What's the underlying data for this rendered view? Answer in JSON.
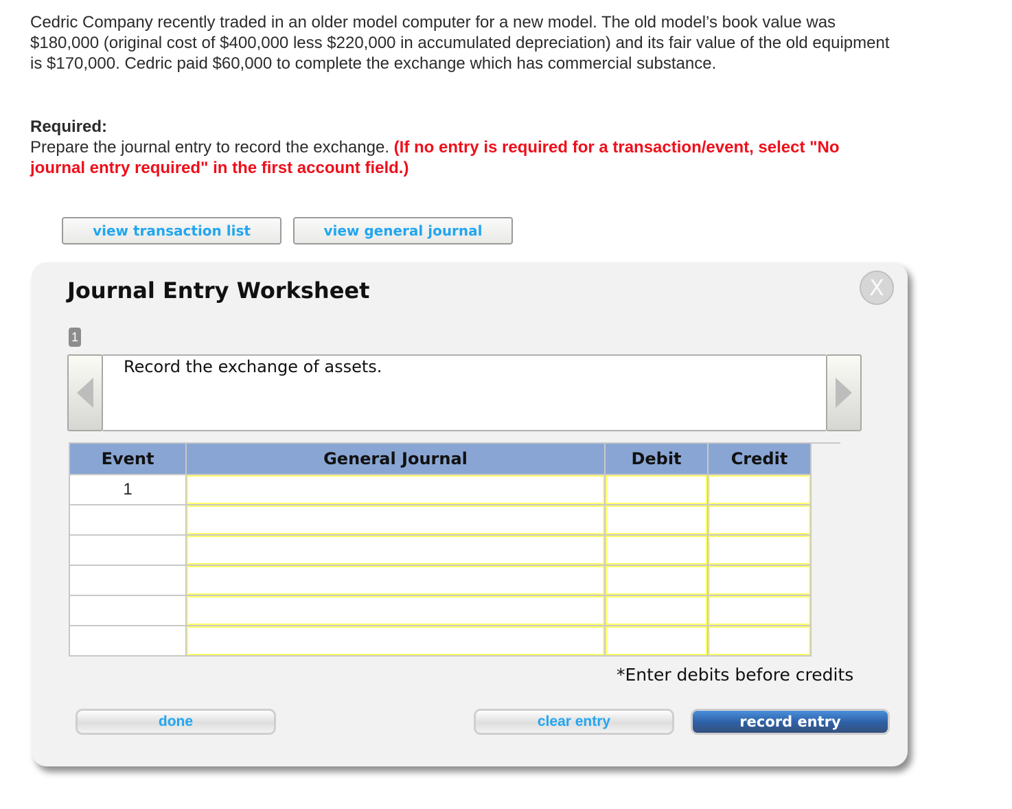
{
  "problem": {
    "text": "Cedric Company recently traded in an older model computer for a new model. The old model’s book value was $180,000 (original cost of $400,000 less $220,000 in accumulated depreciation) and its fair value of the old equipment is $170,000. Cedric paid $60,000 to complete the exchange which has commercial substance."
  },
  "required": {
    "label": "Required:",
    "instruction": "Prepare the journal entry to record the exchange. ",
    "note_red": "(If no entry is required for a transaction/event, select \"No journal entry required\" in the first account field.)"
  },
  "top_buttons": {
    "transaction_list": "view transaction list",
    "general_journal": "view general journal"
  },
  "worksheet": {
    "title": "Journal Entry Worksheet",
    "close_icon": "X",
    "step_number": "1",
    "description": "Record the exchange of assets.",
    "prev_icon": "left-arrow",
    "next_icon": "right-arrow",
    "table": {
      "headers": [
        "Event",
        "General Journal",
        "Debit",
        "Credit"
      ],
      "rows": [
        {
          "event": "1",
          "account": "",
          "debit": "",
          "credit": ""
        },
        {
          "event": "",
          "account": "",
          "debit": "",
          "credit": ""
        },
        {
          "event": "",
          "account": "",
          "debit": "",
          "credit": ""
        },
        {
          "event": "",
          "account": "",
          "debit": "",
          "credit": ""
        },
        {
          "event": "",
          "account": "",
          "debit": "",
          "credit": ""
        },
        {
          "event": "",
          "account": "",
          "debit": "",
          "credit": ""
        }
      ]
    },
    "note": "*Enter debits before credits",
    "buttons": {
      "done": "done",
      "clear": "clear entry",
      "record": "record entry"
    }
  },
  "colors": {
    "link_blue": "#22a6f0",
    "alert_red": "#ee0f1b",
    "header_blue": "#89a5d3",
    "input_border_yellow": "#ffff66",
    "record_button_blue": "#2e62a8"
  }
}
